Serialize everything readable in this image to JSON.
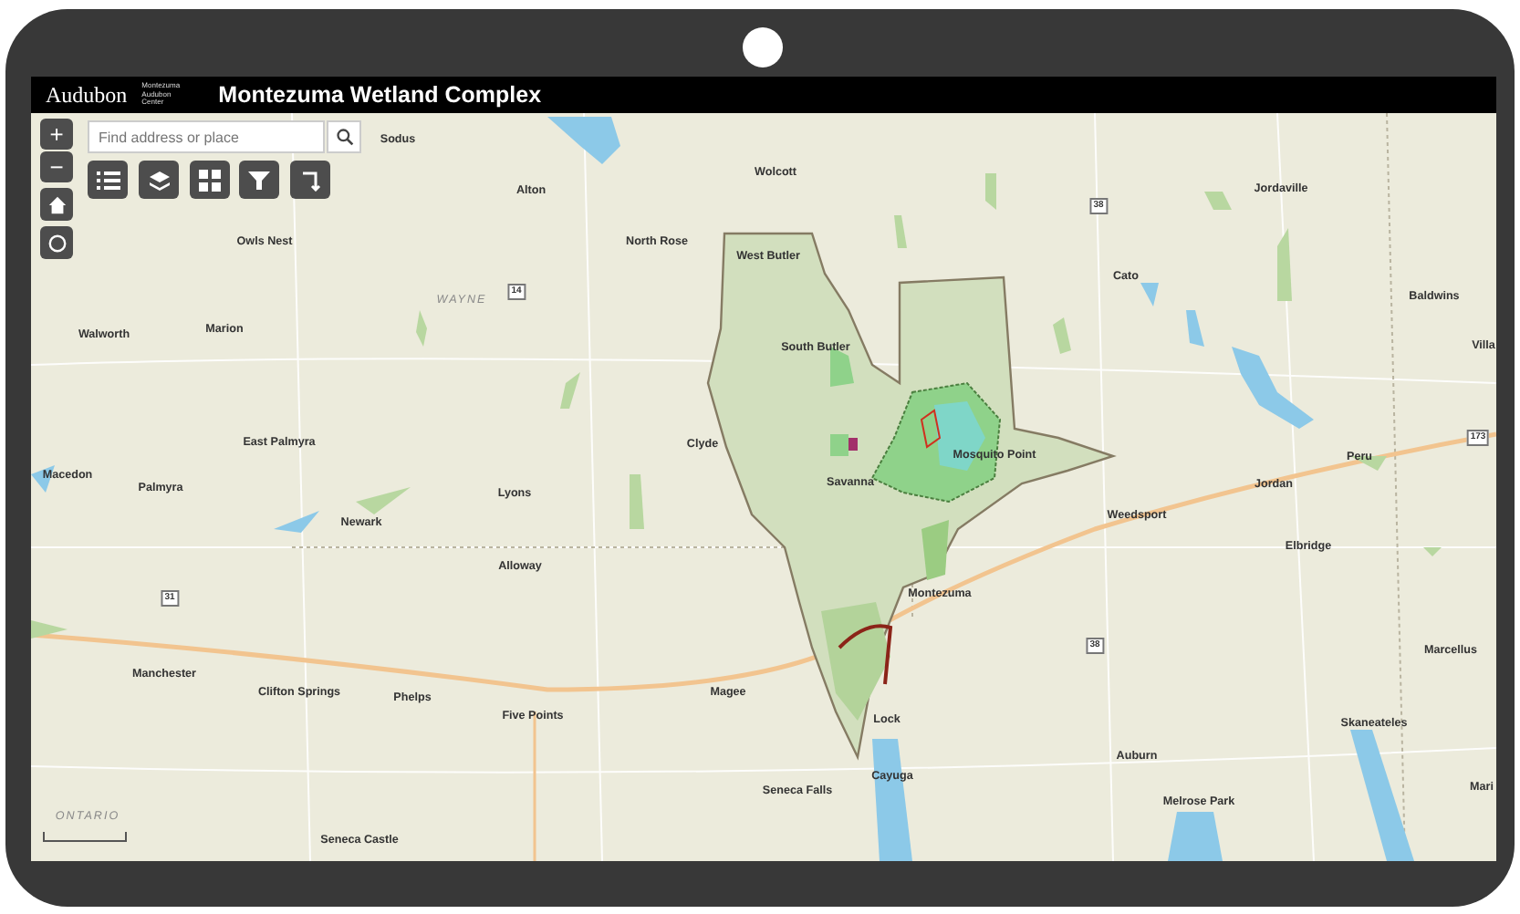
{
  "header": {
    "logo_text": "Audubon",
    "logo_subtitle": "Montezuma Audubon Center",
    "title": "Montezuma Wetland Complex"
  },
  "search": {
    "placeholder": "Find address or place"
  },
  "zoom": {
    "in": "+",
    "out": "−"
  },
  "map_labels": [
    {
      "text": "Sodus",
      "kind": "town"
    },
    {
      "text": "Wolcott",
      "kind": "town"
    },
    {
      "text": "Jordaville",
      "kind": "town"
    },
    {
      "text": "Alton",
      "kind": "town"
    },
    {
      "text": "38",
      "kind": "shield"
    },
    {
      "text": "North Rose",
      "kind": "town"
    },
    {
      "text": "Owls Nest",
      "kind": "town"
    },
    {
      "text": "West Butler",
      "kind": "town"
    },
    {
      "text": "WAYNE",
      "kind": "region"
    },
    {
      "text": "14",
      "kind": "shield"
    },
    {
      "text": "Cato",
      "kind": "town"
    },
    {
      "text": "Baldwins",
      "kind": "town"
    },
    {
      "text": "Marion",
      "kind": "town"
    },
    {
      "text": "Walworth",
      "kind": "town"
    },
    {
      "text": "South Butler",
      "kind": "town"
    },
    {
      "text": "Villa",
      "kind": "town"
    },
    {
      "text": "East Palmyra",
      "kind": "town"
    },
    {
      "text": "Clyde",
      "kind": "town"
    },
    {
      "text": "Mosquito Point",
      "kind": "town"
    },
    {
      "text": "173",
      "kind": "shield"
    },
    {
      "text": "Peru",
      "kind": "town"
    },
    {
      "text": "Macedon",
      "kind": "town"
    },
    {
      "text": "Savanna",
      "kind": "town"
    },
    {
      "text": "Jordan",
      "kind": "town"
    },
    {
      "text": "Palmyra",
      "kind": "town"
    },
    {
      "text": "Lyons",
      "kind": "town"
    },
    {
      "text": "Newark",
      "kind": "town"
    },
    {
      "text": "Weedsport",
      "kind": "town"
    },
    {
      "text": "Elbridge",
      "kind": "town"
    },
    {
      "text": "Alloway",
      "kind": "town"
    },
    {
      "text": "31",
      "kind": "shield"
    },
    {
      "text": "Montezuma",
      "kind": "town"
    },
    {
      "text": "38",
      "kind": "shield"
    },
    {
      "text": "Marcellus",
      "kind": "town"
    },
    {
      "text": "Manchester",
      "kind": "town"
    },
    {
      "text": "Clifton Springs",
      "kind": "town"
    },
    {
      "text": "Magee",
      "kind": "town"
    },
    {
      "text": "Phelps",
      "kind": "town"
    },
    {
      "text": "Five Points",
      "kind": "town"
    },
    {
      "text": "Lock",
      "kind": "town"
    },
    {
      "text": "Skaneateles",
      "kind": "town"
    },
    {
      "text": "Auburn",
      "kind": "town"
    },
    {
      "text": "Cayuga",
      "kind": "town"
    },
    {
      "text": "Seneca Falls",
      "kind": "town"
    },
    {
      "text": "Mari",
      "kind": "town"
    },
    {
      "text": "Melrose Park",
      "kind": "town"
    },
    {
      "text": "ONTARIO",
      "kind": "region"
    },
    {
      "text": "Seneca Castle",
      "kind": "town"
    }
  ]
}
